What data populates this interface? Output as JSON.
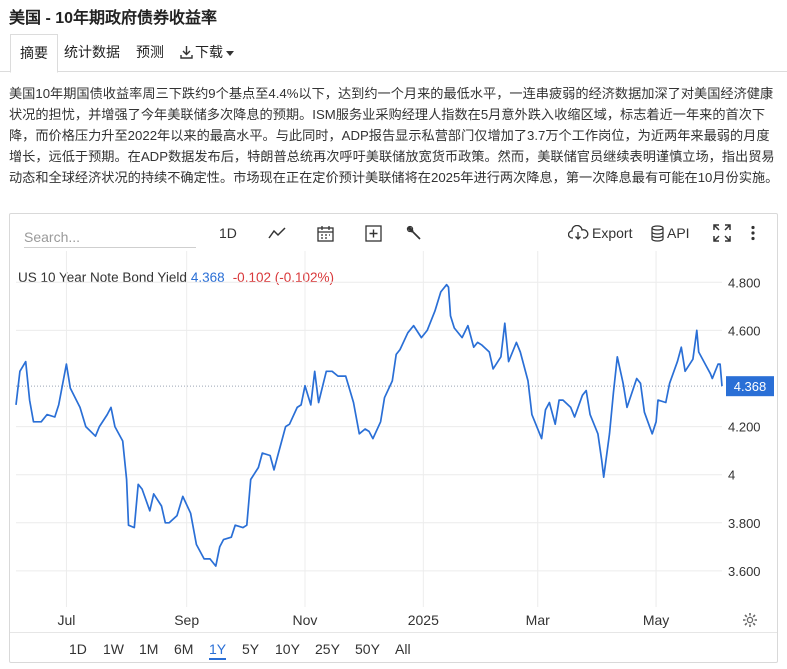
{
  "page_title": "美国 - 10年期政府债券收益率",
  "tabs": [
    {
      "label": "摘要",
      "active": true
    },
    {
      "label": "统计数据"
    },
    {
      "label": "预测"
    },
    {
      "label": "下载"
    }
  ],
  "summary": "美国10年期国债收益率周三下跌约9个基点至4.4%以下，达到约一个月来的最低水平，一连串疲弱的经济数据加深了对美国经济健康状况的担忧，并增强了今年美联储多次降息的预期。ISM服务业采购经理人指数在5月意外跌入收缩区域，标志着近一年来的首次下降，而价格压力升至2022年以来的最高水平。与此同时，ADP报告显示私营部门仅增加了3.7万个工作岗位，为近两年来最弱的月度增长，远低于预期。在ADP数据发布后，特朗普总统再次呼吁美联储放宽货币政策。然而，美联储官员继续表明谨慎立场，指出贸易动态和全球经济状况的持续不确定性。市场现在正在定价预计美联储将在2025年进行两次降息，第一次降息最有可能在10月份实施。",
  "toolbar": {
    "search_placeholder": "Search...",
    "interval": "1D",
    "export": "Export",
    "api": "API",
    "icons": [
      "line-chart-icon",
      "calendar-icon",
      "plus-square-icon",
      "wrench-icon",
      "cloud-download-icon",
      "database-icon",
      "fullscreen-icon",
      "more-vertical-icon",
      "gear-icon"
    ]
  },
  "ranges": [
    {
      "label": "1D"
    },
    {
      "label": "1W"
    },
    {
      "label": "1M"
    },
    {
      "label": "6M"
    },
    {
      "label": "1Y",
      "active": true
    },
    {
      "label": "5Y"
    },
    {
      "label": "10Y"
    },
    {
      "label": "25Y"
    },
    {
      "label": "50Y"
    },
    {
      "label": "All"
    }
  ],
  "chart_data": {
    "type": "line",
    "series_name": "US 10 Year Note Bond Yield",
    "last_value": "4.368",
    "change": "-0.102 (-0.102%)",
    "last_badge": "4.368",
    "y_ticks": [
      "4.800",
      "4.600",
      "4.200",
      "4",
      "3.800",
      "3.600"
    ],
    "y_tick_values": [
      4.8,
      4.6,
      4.2,
      4.0,
      3.8,
      3.6
    ],
    "ylim": [
      3.45,
      4.93
    ],
    "x_ticks": [
      {
        "label": "Jul",
        "date": "2024-07-01"
      },
      {
        "label": "Sep",
        "date": "2024-09-01"
      },
      {
        "label": "Nov",
        "date": "2024-11-01"
      },
      {
        "label": "2025",
        "date": "2025-01-01"
      },
      {
        "label": "Mar",
        "date": "2025-03-01"
      },
      {
        "label": "May",
        "date": "2025-05-01"
      }
    ],
    "xlim": [
      "2024-06-05",
      "2025-06-04"
    ],
    "line_color": "#2a6fd6",
    "points": [
      [
        "2024-06-05",
        4.29
      ],
      [
        "2024-06-07",
        4.43
      ],
      [
        "2024-06-10",
        4.47
      ],
      [
        "2024-06-12",
        4.31
      ],
      [
        "2024-06-14",
        4.22
      ],
      [
        "2024-06-18",
        4.22
      ],
      [
        "2024-06-21",
        4.25
      ],
      [
        "2024-06-25",
        4.24
      ],
      [
        "2024-06-27",
        4.29
      ],
      [
        "2024-07-01",
        4.46
      ],
      [
        "2024-07-03",
        4.36
      ],
      [
        "2024-07-08",
        4.28
      ],
      [
        "2024-07-11",
        4.2
      ],
      [
        "2024-07-16",
        4.16
      ],
      [
        "2024-07-18",
        4.2
      ],
      [
        "2024-07-22",
        4.25
      ],
      [
        "2024-07-24",
        4.28
      ],
      [
        "2024-07-26",
        4.2
      ],
      [
        "2024-07-30",
        4.14
      ],
      [
        "2024-08-01",
        3.98
      ],
      [
        "2024-08-02",
        3.79
      ],
      [
        "2024-08-05",
        3.78
      ],
      [
        "2024-08-07",
        3.96
      ],
      [
        "2024-08-09",
        3.94
      ],
      [
        "2024-08-13",
        3.85
      ],
      [
        "2024-08-15",
        3.92
      ],
      [
        "2024-08-19",
        3.87
      ],
      [
        "2024-08-21",
        3.8
      ],
      [
        "2024-08-23",
        3.8
      ],
      [
        "2024-08-27",
        3.83
      ],
      [
        "2024-08-30",
        3.91
      ],
      [
        "2024-09-03",
        3.84
      ],
      [
        "2024-09-06",
        3.71
      ],
      [
        "2024-09-10",
        3.65
      ],
      [
        "2024-09-13",
        3.65
      ],
      [
        "2024-09-16",
        3.62
      ],
      [
        "2024-09-18",
        3.7
      ],
      [
        "2024-09-20",
        3.73
      ],
      [
        "2024-09-24",
        3.74
      ],
      [
        "2024-09-26",
        3.79
      ],
      [
        "2024-09-30",
        3.78
      ],
      [
        "2024-10-02",
        3.79
      ],
      [
        "2024-10-04",
        3.98
      ],
      [
        "2024-10-08",
        4.03
      ],
      [
        "2024-10-10",
        4.09
      ],
      [
        "2024-10-14",
        4.08
      ],
      [
        "2024-10-16",
        4.02
      ],
      [
        "2024-10-18",
        4.08
      ],
      [
        "2024-10-22",
        4.2
      ],
      [
        "2024-10-24",
        4.21
      ],
      [
        "2024-10-28",
        4.28
      ],
      [
        "2024-10-30",
        4.29
      ],
      [
        "2024-11-01",
        4.37
      ],
      [
        "2024-11-04",
        4.29
      ],
      [
        "2024-11-06",
        4.43
      ],
      [
        "2024-11-08",
        4.3
      ],
      [
        "2024-11-12",
        4.43
      ],
      [
        "2024-11-15",
        4.43
      ],
      [
        "2024-11-18",
        4.41
      ],
      [
        "2024-11-20",
        4.41
      ],
      [
        "2024-11-22",
        4.41
      ],
      [
        "2024-11-26",
        4.3
      ],
      [
        "2024-11-29",
        4.17
      ],
      [
        "2024-12-02",
        4.19
      ],
      [
        "2024-12-04",
        4.18
      ],
      [
        "2024-12-06",
        4.15
      ],
      [
        "2024-12-10",
        4.22
      ],
      [
        "2024-12-12",
        4.32
      ],
      [
        "2024-12-16",
        4.39
      ],
      [
        "2024-12-18",
        4.5
      ],
      [
        "2024-12-20",
        4.52
      ],
      [
        "2024-12-24",
        4.59
      ],
      [
        "2024-12-27",
        4.62
      ],
      [
        "2024-12-31",
        4.57
      ],
      [
        "2025-01-03",
        4.6
      ],
      [
        "2025-01-07",
        4.68
      ],
      [
        "2025-01-10",
        4.76
      ],
      [
        "2025-01-13",
        4.79
      ],
      [
        "2025-01-14",
        4.78
      ],
      [
        "2025-01-15",
        4.66
      ],
      [
        "2025-01-17",
        4.61
      ],
      [
        "2025-01-21",
        4.57
      ],
      [
        "2025-01-24",
        4.62
      ],
      [
        "2025-01-27",
        4.53
      ],
      [
        "2025-01-29",
        4.55
      ],
      [
        "2025-01-31",
        4.54
      ],
      [
        "2025-02-04",
        4.51
      ],
      [
        "2025-02-06",
        4.44
      ],
      [
        "2025-02-10",
        4.49
      ],
      [
        "2025-02-12",
        4.63
      ],
      [
        "2025-02-14",
        4.47
      ],
      [
        "2025-02-18",
        4.55
      ],
      [
        "2025-02-20",
        4.51
      ],
      [
        "2025-02-24",
        4.39
      ],
      [
        "2025-02-26",
        4.25
      ],
      [
        "2025-02-28",
        4.21
      ],
      [
        "2025-03-03",
        4.15
      ],
      [
        "2025-03-05",
        4.27
      ],
      [
        "2025-03-07",
        4.3
      ],
      [
        "2025-03-10",
        4.21
      ],
      [
        "2025-03-12",
        4.31
      ],
      [
        "2025-03-14",
        4.31
      ],
      [
        "2025-03-18",
        4.28
      ],
      [
        "2025-03-20",
        4.24
      ],
      [
        "2025-03-24",
        4.33
      ],
      [
        "2025-03-26",
        4.35
      ],
      [
        "2025-03-28",
        4.25
      ],
      [
        "2025-04-01",
        4.17
      ],
      [
        "2025-04-03",
        4.06
      ],
      [
        "2025-04-04",
        3.99
      ],
      [
        "2025-04-07",
        4.17
      ],
      [
        "2025-04-09",
        4.34
      ],
      [
        "2025-04-11",
        4.49
      ],
      [
        "2025-04-14",
        4.38
      ],
      [
        "2025-04-16",
        4.28
      ],
      [
        "2025-04-21",
        4.4
      ],
      [
        "2025-04-23",
        4.38
      ],
      [
        "2025-04-25",
        4.26
      ],
      [
        "2025-04-29",
        4.17
      ],
      [
        "2025-05-01",
        4.22
      ],
      [
        "2025-05-02",
        4.31
      ],
      [
        "2025-05-06",
        4.3
      ],
      [
        "2025-05-08",
        4.38
      ],
      [
        "2025-05-12",
        4.47
      ],
      [
        "2025-05-14",
        4.53
      ],
      [
        "2025-05-16",
        4.43
      ],
      [
        "2025-05-20",
        4.48
      ],
      [
        "2025-05-22",
        4.6
      ],
      [
        "2025-05-23",
        4.51
      ],
      [
        "2025-05-27",
        4.45
      ],
      [
        "2025-05-29",
        4.42
      ],
      [
        "2025-05-30",
        4.4
      ],
      [
        "2025-06-02",
        4.46
      ],
      [
        "2025-06-03",
        4.46
      ],
      [
        "2025-06-04",
        4.368
      ]
    ]
  }
}
